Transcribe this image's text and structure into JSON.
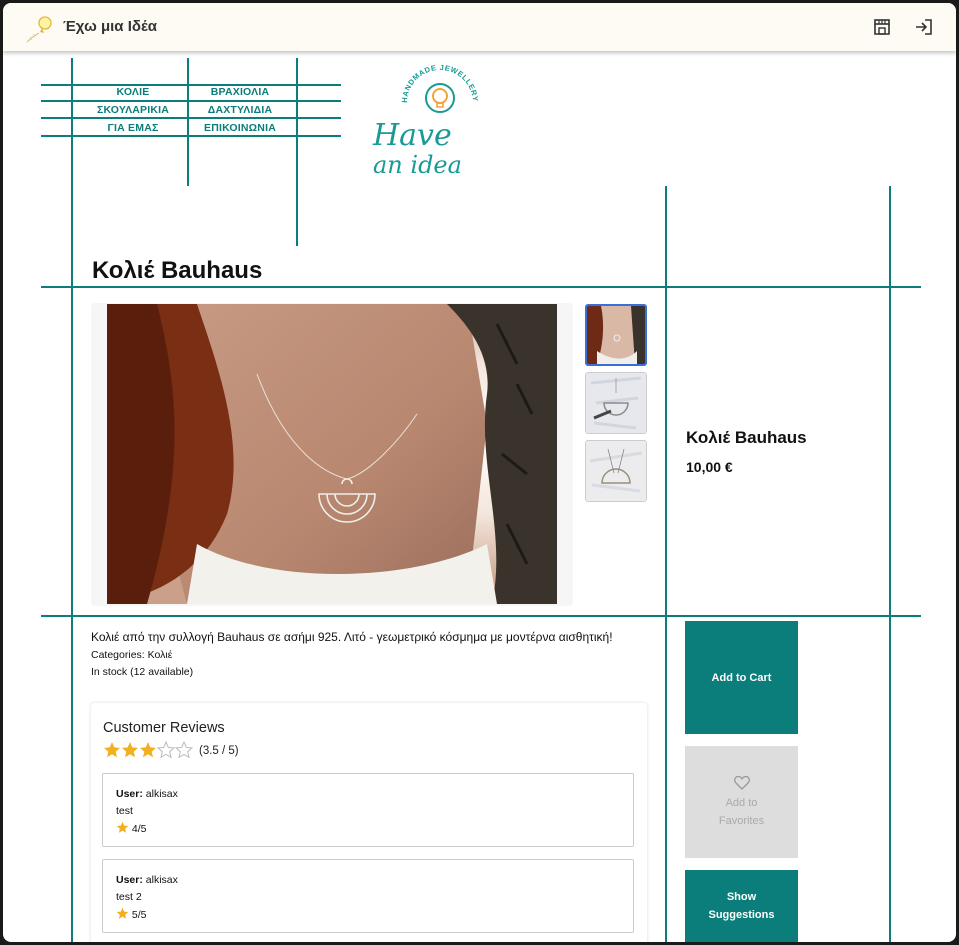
{
  "topbar": {
    "title": "Έχω μια Ιδέα",
    "store_icon": "store-icon",
    "login_icon": "login-icon"
  },
  "nav": {
    "necklaces": "ΚΟΛΙΕ",
    "bracelets": "ΒΡΑΧΙΟΛΙΑ",
    "earrings": "ΣΚΟΥΛΑΡΙΚΙΑ",
    "rings": "ΔΑΧΤΥΛΙΔΙΑ",
    "about": "ΓΙΑ ΕΜΑΣ",
    "contact": "ΕΠΙΚΟΙΝΩΝΙΑ"
  },
  "logo": {
    "arc_text": "HANDMADE JEWELLERY",
    "line1": "Have",
    "line2": "an idea"
  },
  "product": {
    "title": "Κολιέ Bauhaus",
    "price": "10,00 €",
    "description": "Κολιέ από την συλλογή Bauhaus σε ασήμι 925. Λιτό - γεωμετρικό κόσμημα με μοντέρνα αισθητική!",
    "categories_label": "Categories:",
    "categories_value": "Κολιέ",
    "stock": "In stock (12 available)"
  },
  "reviews": {
    "title": "Customer Reviews",
    "average": 3.5,
    "score_text": "(3.5 / 5)",
    "items": [
      {
        "user_label": "User:",
        "user": "alkisax",
        "text": "test",
        "rating": "4/5"
      },
      {
        "user_label": "User:",
        "user": "alkisax",
        "text": "test 2",
        "rating": "5/5"
      }
    ]
  },
  "actions": {
    "add_to_cart": "Add to Cart",
    "add_to_favorites_1": "Add to",
    "add_to_favorites_2": "Favorites",
    "show_suggestions_1": "Show",
    "show_suggestions_2": "Suggestions"
  },
  "colors": {
    "accent": "#0b7d7a",
    "star": "#f2b01e",
    "selected_border": "#3a6fd8"
  }
}
